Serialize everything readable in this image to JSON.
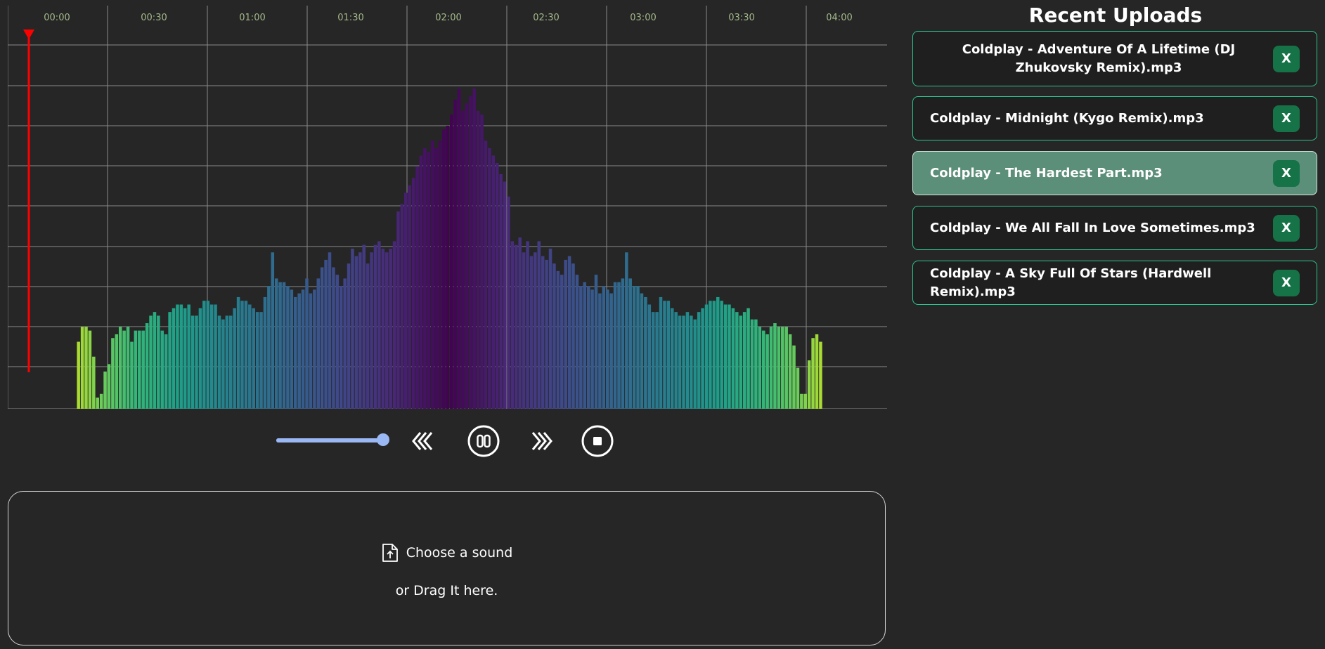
{
  "visualizer": {
    "time_labels": [
      "00:00",
      "00:30",
      "01:00",
      "01:30",
      "02:00",
      "02:30",
      "03:00",
      "03:30",
      "04:00"
    ],
    "playhead_color": "#ff0000",
    "bar_colormap": "viridis",
    "spectrum_levels": [
      0.0,
      0.18,
      0.22,
      0.22,
      0.21,
      0.14,
      0.03,
      0.04,
      0.1,
      0.12,
      0.19,
      0.2,
      0.22,
      0.21,
      0.22,
      0.18,
      0.21,
      0.21,
      0.21,
      0.23,
      0.25,
      0.26,
      0.25,
      0.21,
      0.2,
      0.26,
      0.27,
      0.28,
      0.28,
      0.27,
      0.28,
      0.25,
      0.25,
      0.27,
      0.29,
      0.29,
      0.28,
      0.28,
      0.25,
      0.24,
      0.25,
      0.25,
      0.27,
      0.3,
      0.29,
      0.29,
      0.28,
      0.27,
      0.26,
      0.26,
      0.3,
      0.33,
      0.42,
      0.35,
      0.34,
      0.34,
      0.33,
      0.32,
      0.3,
      0.31,
      0.32,
      0.35,
      0.31,
      0.32,
      0.35,
      0.38,
      0.4,
      0.42,
      0.38,
      0.36,
      0.33,
      0.35,
      0.39,
      0.43,
      0.41,
      0.42,
      0.44,
      0.39,
      0.42,
      0.44,
      0.45,
      0.43,
      0.42,
      0.43,
      0.45,
      0.53,
      0.55,
      0.58,
      0.6,
      0.62,
      0.65,
      0.68,
      0.7,
      0.69,
      0.72,
      0.7,
      0.72,
      0.75,
      0.76,
      0.79,
      0.83,
      0.86,
      0.8,
      0.82,
      0.84,
      0.86,
      0.8,
      0.79,
      0.72,
      0.7,
      0.68,
      0.66,
      0.63,
      0.61,
      0.57,
      0.45,
      0.44,
      0.46,
      0.42,
      0.45,
      0.41,
      0.42,
      0.45,
      0.41,
      0.4,
      0.43,
      0.39,
      0.37,
      0.36,
      0.4,
      0.41,
      0.39,
      0.36,
      0.33,
      0.34,
      0.33,
      0.32,
      0.36,
      0.31,
      0.33,
      0.32,
      0.31,
      0.34,
      0.34,
      0.35,
      0.42,
      0.35,
      0.33,
      0.33,
      0.31,
      0.3,
      0.28,
      0.26,
      0.26,
      0.3,
      0.29,
      0.29,
      0.27,
      0.26,
      0.25,
      0.25,
      0.26,
      0.25,
      0.24,
      0.26,
      0.27,
      0.28,
      0.29,
      0.29,
      0.3,
      0.29,
      0.28,
      0.28,
      0.27,
      0.26,
      0.25,
      0.26,
      0.27,
      0.24,
      0.24,
      0.22,
      0.21,
      0.2,
      0.22,
      0.23,
      0.22,
      0.22,
      0.22,
      0.2,
      0.17,
      0.11,
      0.04,
      0.04,
      0.13,
      0.19,
      0.2,
      0.18,
      0.0
    ]
  },
  "controls": {
    "volume": 1.0,
    "rewind_label": "Rewind",
    "pause_label": "Pause",
    "forward_label": "Fast forward",
    "stop_label": "Stop"
  },
  "dropzone": {
    "choose_text": "Choose a sound",
    "drag_text": "or Drag It here."
  },
  "uploads": {
    "title": "Recent Uploads",
    "remove_label": "X",
    "accent_color": "#2fc58f",
    "remove_button_color": "#157347",
    "selected_color": "#5c8f79",
    "items": [
      {
        "name": "Coldplay - Adventure Of A Lifetime (DJ Zhukovsky Remix).mp3",
        "selected": false
      },
      {
        "name": "Coldplay - Midnight (Kygo Remix).mp3",
        "selected": false
      },
      {
        "name": "Coldplay - The Hardest Part.mp3",
        "selected": true
      },
      {
        "name": "Coldplay - We All Fall In Love Sometimes.mp3",
        "selected": false
      },
      {
        "name": "Coldplay - A Sky Full Of Stars (Hardwell Remix).mp3",
        "selected": false
      }
    ]
  }
}
